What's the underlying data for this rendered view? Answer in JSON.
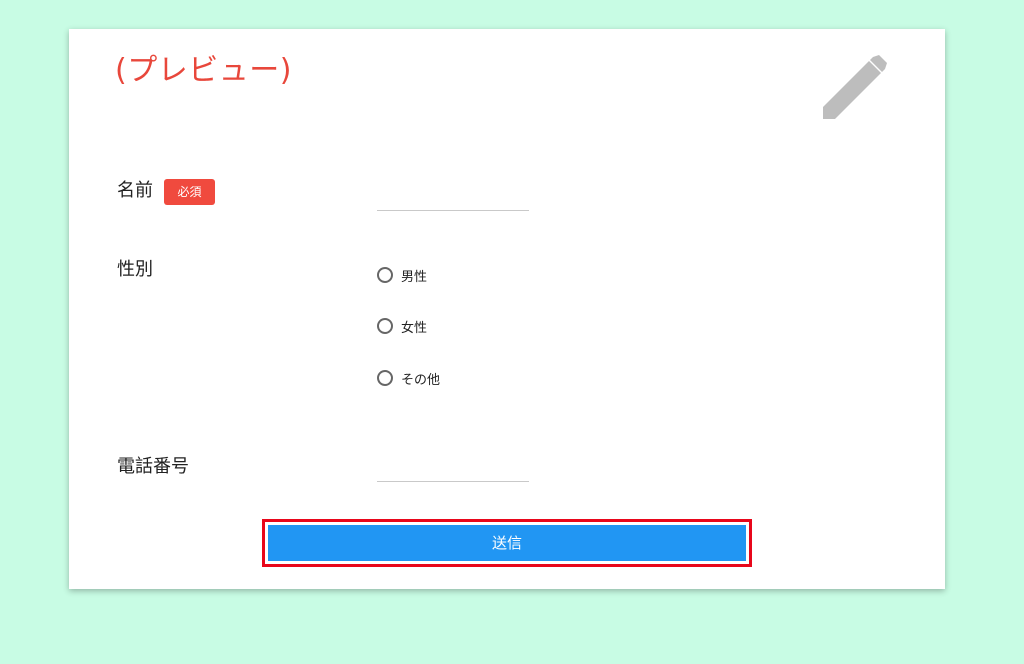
{
  "header": {
    "preview_title": "(プレビュー)",
    "edit_icon": "pencil-icon"
  },
  "form": {
    "name": {
      "label": "名前",
      "required_badge": "必須",
      "value": ""
    },
    "gender": {
      "label": "性別",
      "options": [
        "男性",
        "女性",
        "その他"
      ],
      "selected": null
    },
    "phone": {
      "label": "電話番号",
      "value": ""
    },
    "submit_label": "送信"
  },
  "colors": {
    "background": "#c8fce4",
    "title": "#e8473b",
    "required_badge": "#f04a3e",
    "submit_button": "#2196f3",
    "highlight_frame": "#e8071b",
    "icon": "#bdbdbd"
  }
}
